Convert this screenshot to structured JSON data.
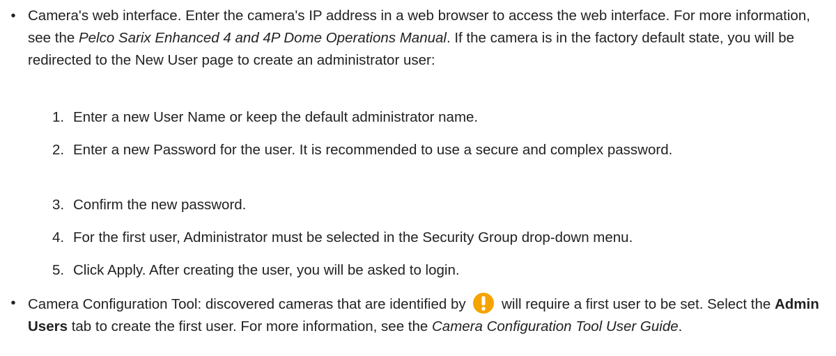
{
  "bullet1": {
    "marker": "•",
    "text_a": "Camera's web interface. Enter the camera's IP address in a web browser to access the web interface. For more information, see the ",
    "manual_title": "Pelco Sarix Enhanced 4 and 4P Dome Operations Manual",
    "text_b": ". If the camera is in the factory default state, you will be redirected to the New User page to create an administrator user:"
  },
  "steps": [
    {
      "num": "1.",
      "text": "Enter a new User Name or keep the default administrator name."
    },
    {
      "num": "2.",
      "text": "Enter a new Password for the user. It is recommended to use a secure and complex password."
    },
    {
      "num": "3.",
      "text": "Confirm the new password."
    },
    {
      "num": "4.",
      "text": "For the first user, Administrator must be selected in the Security Group drop-down menu."
    },
    {
      "num": "5.",
      "text": "Click Apply. After creating the user, you will be asked to login."
    }
  ],
  "bullet2": {
    "marker": "•",
    "text_a": "Camera Configuration Tool: discovered cameras that are identified by",
    "icon": "warning-exclamation-icon",
    "text_b": "will require a first user to be set. Select the ",
    "tab_name": "Admin Users",
    "text_c": " tab to create the first user. For more information, see the ",
    "guide_title": "Camera Configuration Tool User Guide",
    "text_d": "."
  },
  "colors": {
    "text": "#222222",
    "icon_fill": "#f5a300",
    "icon_mark": "#ffffff"
  }
}
